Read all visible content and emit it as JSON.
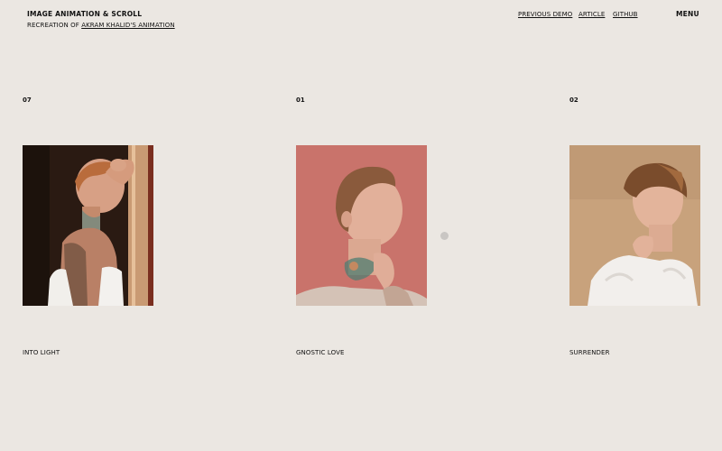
{
  "header": {
    "title": "IMAGE ANIMATION & SCROLL",
    "subtitle_prefix": "RECREATION OF",
    "subtitle_link": "AKRAM KHALID'S ANIMATION"
  },
  "nav": {
    "previous_demo": "PREVIOUS DEMO",
    "article": "ARTICLE",
    "github": "GITHUB",
    "menu": "MENU"
  },
  "gallery": [
    {
      "number": "07",
      "title": "INTO LIGHT"
    },
    {
      "number": "01",
      "title": "GNOSTIC LOVE"
    },
    {
      "number": "02",
      "title": "SURRENDER"
    }
  ],
  "colors": {
    "background": "#ebe7e2",
    "text": "#111111",
    "photo_1_bg": "#2a1a12",
    "photo_2_bg": "#c9736b",
    "photo_3_bg": "#c8a27c"
  }
}
